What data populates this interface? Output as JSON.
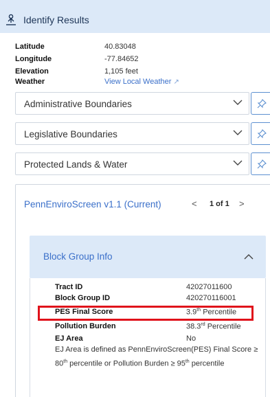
{
  "header": {
    "title": "Identify Results",
    "icon": "person-pin-icon"
  },
  "location": [
    {
      "label": "Latitude",
      "value": "40.83048"
    },
    {
      "label": "Longitude",
      "value": "-77.84652"
    },
    {
      "label": "Elevation",
      "value": "1,105 feet"
    },
    {
      "label": "Weather",
      "value": "View Local Weather",
      "link": true
    }
  ],
  "accordions": [
    {
      "label": "Administrative Boundaries"
    },
    {
      "label": "Legislative Boundaries"
    },
    {
      "label": "Protected Lands & Water"
    }
  ],
  "pes": {
    "title": "PennEnviroScreen v1.1 (Current)",
    "prev": "<",
    "count": "1 of 1",
    "next": ">",
    "section": "Block Group Info",
    "rows": [
      {
        "label": "Tract ID",
        "value": "42027011600"
      },
      {
        "label": "Block Group ID",
        "value": "420270116001"
      },
      {
        "label": "PES Final Score",
        "value_num": "3.9",
        "value_sup": "th",
        "value_rest": " Percentile"
      },
      {
        "label": "Pollution Burden",
        "value_num": "38.3",
        "value_sup": "rd",
        "value_rest": " Percentile"
      },
      {
        "label": "EJ Area",
        "value": "No"
      }
    ],
    "note": {
      "part1": "EJ Area is defined as PennEnviroScreen(PES) Final Score ≥ 80",
      "sup1": "th",
      "part2": " percentile or Pollution Burden ≥ 95",
      "sup2": "th",
      "part3": " percentile"
    }
  },
  "colors": {
    "header_bg": "#dce9f8",
    "link": "#3a6fc9",
    "highlight": "#e0121b"
  }
}
